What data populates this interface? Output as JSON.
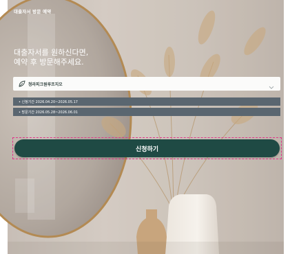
{
  "header": {
    "title": "대출자서 방문 예약"
  },
  "headline": {
    "line1": "대출자서를 원하신다면,",
    "line2": "예약 후 방문해주세요."
  },
  "location_select": {
    "icon": "leaf-icon",
    "selected": "청라피크원루프지오"
  },
  "periods": [
    {
      "text": "• 신청기간 2026.04.20~2026.05.17"
    },
    {
      "text": "• 방문기간 2026.05.28~2026.06.01"
    }
  ],
  "cta": {
    "label": "신청하기"
  },
  "colors": {
    "cta": "#1f4a44",
    "period_bar": "#5a6670",
    "highlight": "#e0338a"
  }
}
